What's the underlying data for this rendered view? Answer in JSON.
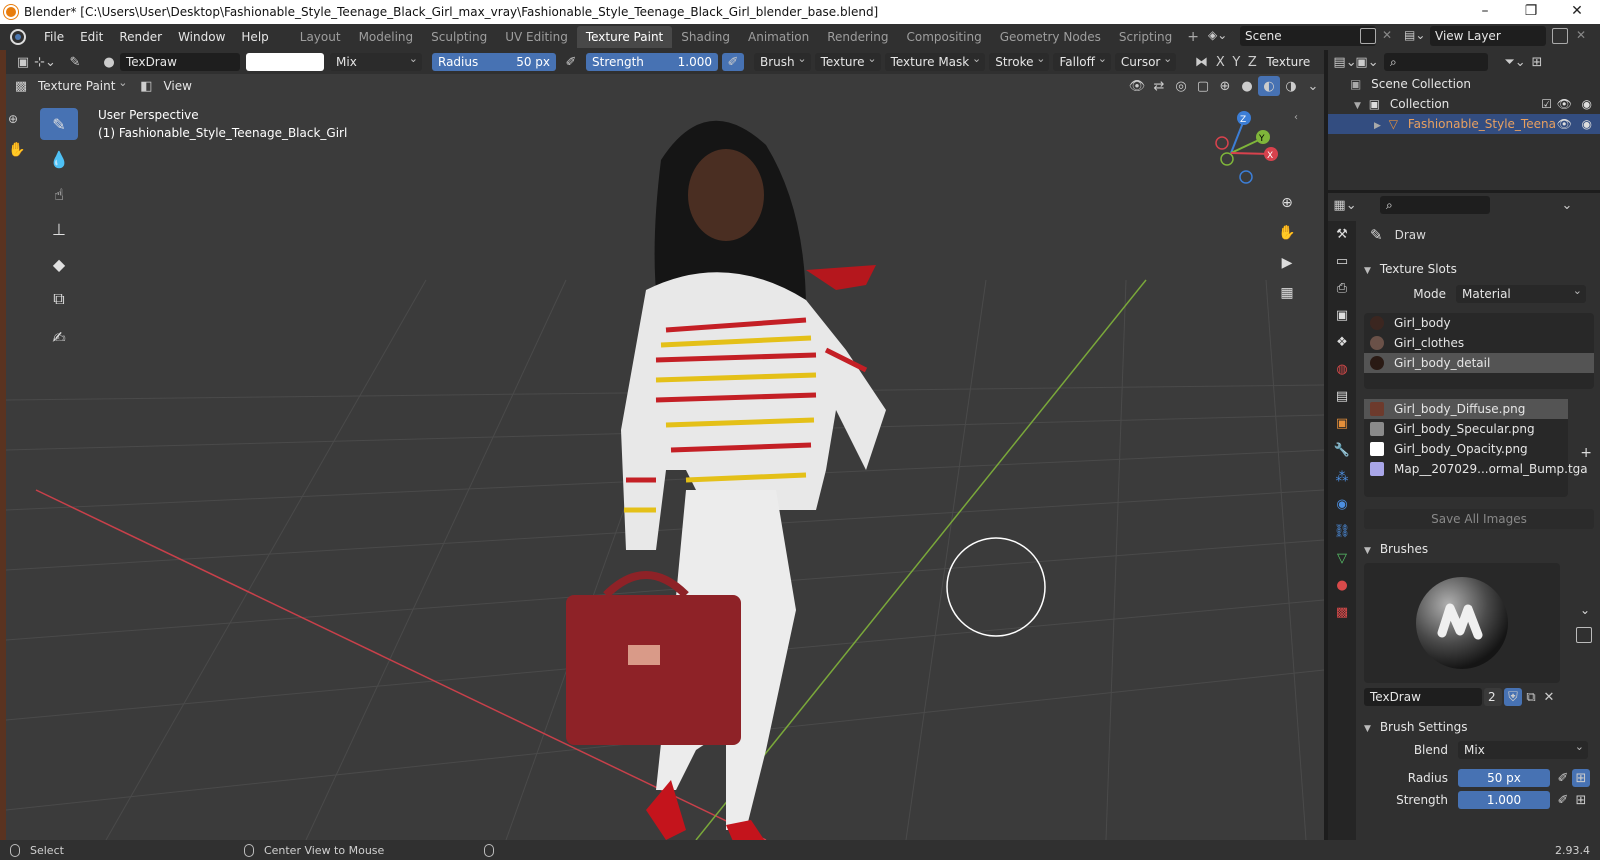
{
  "window": {
    "title": "Blender* [C:\\Users\\User\\Desktop\\Fashionable_Style_Teenage_Black_Girl_max_vray\\Fashionable_Style_Teenage_Black_Girl_blender_base.blend]",
    "minimize": "–",
    "maximize": "❐",
    "close": "✕"
  },
  "menu": [
    "File",
    "Edit",
    "Render",
    "Window",
    "Help"
  ],
  "workspaces": [
    "Layout",
    "Modeling",
    "Sculpting",
    "UV Editing",
    "Texture Paint",
    "Shading",
    "Animation",
    "Rendering",
    "Compositing",
    "Geometry Nodes",
    "Scripting"
  ],
  "active_workspace": "Texture Paint",
  "scene": "Scene",
  "view_layer": "View Layer",
  "tool_header": {
    "brush_name": "TexDraw",
    "blend": "Mix",
    "radius_label": "Radius",
    "radius_value": "50 px",
    "strength_label": "Strength",
    "strength_value": "1.000",
    "brush": "Brush",
    "texture": "Texture",
    "texture_mask": "Texture Mask",
    "stroke": "Stroke",
    "falloff": "Falloff",
    "cursor": "Cursor",
    "x": "X",
    "y": "Y",
    "z": "Z",
    "texture_slot": "Texture"
  },
  "view_header": {
    "mode": "Texture Paint",
    "view": "View"
  },
  "viewport": {
    "perspective": "User Perspective",
    "object": "(1) Fashionable_Style_Teenage_Black_Girl",
    "gizmo_x": "X",
    "gizmo_y": "Y",
    "gizmo_z": "Z"
  },
  "outliner": {
    "scene_collection": "Scene Collection",
    "collection": "Collection",
    "object": "Fashionable_Style_Teena"
  },
  "properties": {
    "tool": "Draw",
    "texture_slots": {
      "title": "Texture Slots",
      "mode_label": "Mode",
      "mode_value": "Material",
      "materials": [
        "Girl_body",
        "Girl_clothes",
        "Girl_body_detail"
      ],
      "images": [
        "Girl_body_Diffuse.png",
        "Girl_body_Specular.png",
        "Girl_body_Opacity.png",
        "Map__207029...ormal_Bump.tga"
      ],
      "save_all": "Save All Images"
    },
    "brushes": {
      "title": "Brushes",
      "name": "TexDraw",
      "users": "2"
    },
    "brush_settings": {
      "title": "Brush Settings",
      "blend_label": "Blend",
      "blend_value": "Mix",
      "radius_label": "Radius",
      "radius_value": "50 px",
      "strength_label": "Strength",
      "strength_value": "1.000"
    }
  },
  "status": {
    "select": "Select",
    "center_view": "Center View to Mouse",
    "version": "2.93.4"
  },
  "colors": {
    "accent": "#4772b3",
    "x_axis": "#d8424d",
    "y_axis": "#7fb53a",
    "z_axis": "#3c7ed6"
  }
}
